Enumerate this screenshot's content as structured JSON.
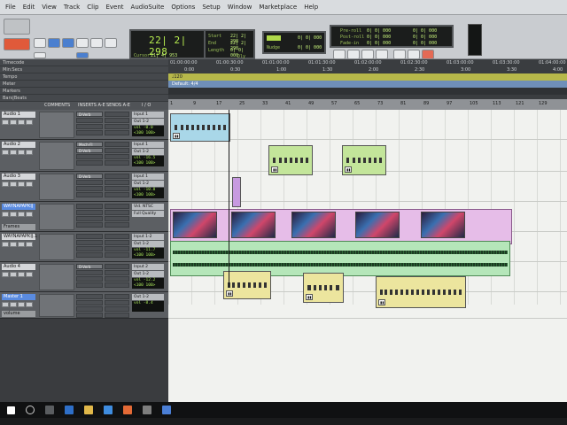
{
  "menu": [
    "File",
    "Edit",
    "View",
    "Track",
    "Clip",
    "Event",
    "AudioSuite",
    "Options",
    "Setup",
    "Window",
    "Marketplace",
    "Help"
  ],
  "toolbar": {
    "main_counter": "22| 2| 298",
    "start_label": "Start",
    "end_label": "End",
    "length_label": "Length",
    "start_val": "22| 2| 298",
    "end_val": "22| 2| 298",
    "length_val": "0| 0| 000",
    "cursor_label": "Cursor",
    "cursor_val": "21| 4| 953",
    "dly_label": "Dly",
    "nudge_label": "Nudge",
    "nudge_val": "0| 0| 000",
    "grid_val": "0| 0| 000",
    "preroll_label": "Pre-roll",
    "postroll_label": "Post-roll",
    "fadein_label": "Fade-in",
    "preroll_val": "0| 0| 000",
    "postroll_val": "0| 0| 000",
    "fadein_val": "0| 0| 000",
    "transport_start": "0| 0| 000",
    "transport_end": "0| 0| 000",
    "transport_length": "0| 0| 000"
  },
  "rulers": {
    "names": [
      "Timecode",
      "Min:Secs",
      "Tempo",
      "Meter",
      "Markers",
      "Bars|Beats"
    ],
    "timecode_ticks": [
      "01:00:00:00",
      "01:00:30:00",
      "01:01:00:00",
      "01:01:30:00",
      "01:02:00:00",
      "01:02:30:00",
      "01:03:00:00",
      "01:03:30:00",
      "01:04:00:00"
    ],
    "minsec_ticks": [
      "0:00",
      "0:30",
      "1:00",
      "1:30",
      "2:00",
      "2:30",
      "3:00",
      "3:30",
      "4:00"
    ],
    "tempo": "♩120",
    "meter": "Default: 4/4",
    "bar_ticks": [
      "1",
      "9",
      "17",
      "25",
      "33",
      "41",
      "49",
      "57",
      "65",
      "73",
      "81",
      "89",
      "97",
      "105",
      "113",
      "121",
      "129"
    ]
  },
  "columns": {
    "comments": "COMMENTS",
    "inserts": "INSERTS A-E",
    "sends": "SENDS A-E",
    "io": "I / O"
  },
  "tracks": [
    {
      "name": "Audio 1",
      "inserts": [
        "D-Verb"
      ],
      "io": [
        "Input 1",
        "Out 1-2"
      ],
      "vol": "vol -0.0",
      "pan": "<100 100>"
    },
    {
      "name": "Audio 2",
      "inserts": [
        "Mech-Fl",
        "D-Verb"
      ],
      "io": [
        "Input 1",
        "Out 1-2"
      ],
      "vol": "vol -16.5",
      "pan": "<100 100>"
    },
    {
      "name": "Audio 3",
      "inserts": [
        "D-Verb"
      ],
      "io": [
        "Input 1",
        "Out 1-2"
      ],
      "vol": "vol -10.8",
      "pan": "<100 100>"
    },
    {
      "name": "WAYNAPAPKIJ",
      "inserts": [],
      "io": [
        "Vid. NTSC",
        "Full Quality"
      ],
      "vol": "",
      "pan": "",
      "extra": "Frames"
    },
    {
      "name": "WAYNAPAPKIJ.1",
      "inserts": [],
      "io": [
        "Input 1-2",
        "Out 1-2"
      ],
      "vol": "vol -11.7",
      "pan": "<100 100>"
    },
    {
      "name": "Audio 4",
      "inserts": [
        "D-Verb"
      ],
      "io": [
        "Input 2",
        "Out 1-2"
      ],
      "vol": "vol -12.2",
      "pan": "<100 100>"
    },
    {
      "name": "Master 1",
      "inserts": [],
      "io": [
        "Out 1-2"
      ],
      "vol": "vol -8.4",
      "pan": "",
      "extra": "volume"
    }
  ]
}
